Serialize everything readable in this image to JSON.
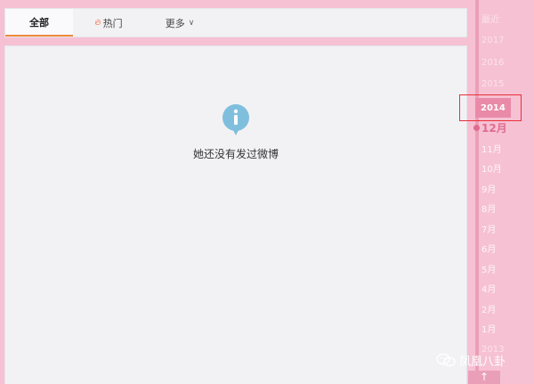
{
  "tabs": {
    "all_label": "全部",
    "hot_label": "热门",
    "more_label": "更多"
  },
  "main": {
    "empty_message": "她还没有发过微博"
  },
  "timeline": {
    "items": [
      "最近",
      "2017",
      "2016",
      "2015",
      "2014",
      "12月",
      "11月",
      "10月",
      "9月",
      "8月",
      "7月",
      "6月",
      "5月",
      "4月",
      "2月",
      "1月",
      "2013"
    ],
    "active_year": "2014",
    "active_month": "12月"
  },
  "watermark": {
    "text": "凤凰八卦"
  },
  "colors": {
    "background": "#f6c1d3",
    "accent_tab": "#f08a3c",
    "info_icon": "#7fbfdd",
    "highlight_box": "#e8303a"
  }
}
